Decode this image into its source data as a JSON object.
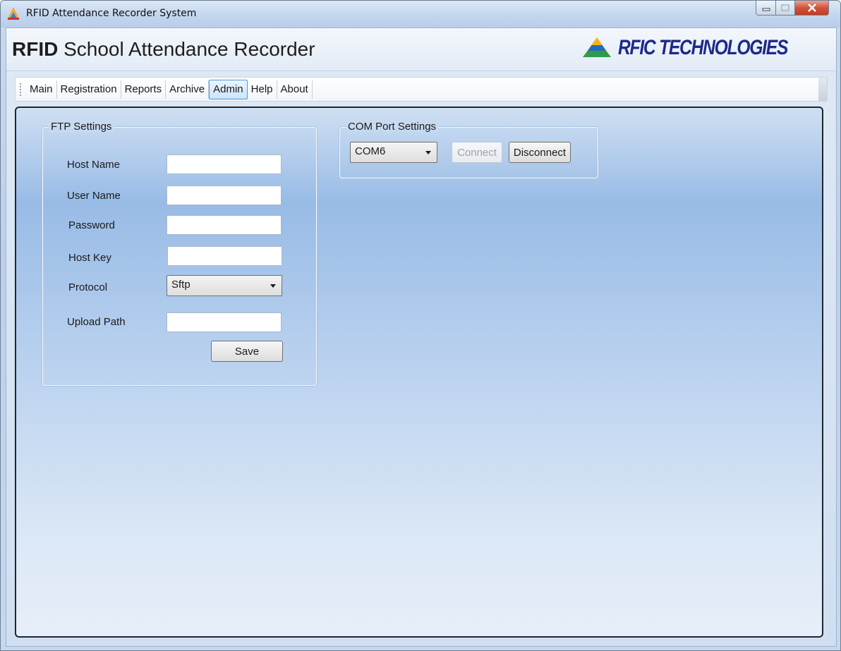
{
  "window": {
    "title": "RFID Attendance Recorder System",
    "controls": [
      "minimize-icon",
      "maximize-icon",
      "close-icon"
    ]
  },
  "header": {
    "title_bold": "RFID",
    "title_rest": " School Attendance Recorder",
    "logo_text": "RFIC TECHNOLOGIES"
  },
  "menu": {
    "items": [
      {
        "label": "Main",
        "active": false
      },
      {
        "label": "Registration",
        "active": false
      },
      {
        "label": "Reports",
        "active": false
      },
      {
        "label": "Archive",
        "active": false
      },
      {
        "label": "Admin",
        "active": true
      },
      {
        "label": "Help",
        "active": false
      },
      {
        "label": "About",
        "active": false
      }
    ]
  },
  "ftp": {
    "group_title": "FTP Settings",
    "host_name_label": "Host Name",
    "host_name_value": "",
    "user_name_label": "User Name",
    "user_name_value": "",
    "password_label": "Password",
    "password_value": "",
    "host_key_label": "Host Key",
    "host_key_value": "",
    "protocol_label": "Protocol",
    "protocol_value": "Sftp",
    "upload_path_label": "Upload Path",
    "upload_path_value": "",
    "save_label": "Save"
  },
  "com": {
    "group_title": "COM Port Settings",
    "port_value": "COM6",
    "connect_label": "Connect",
    "connect_enabled": false,
    "disconnect_label": "Disconnect"
  },
  "colors": {
    "logo_text": "#1c2a8a",
    "active_menu_border": "#4b9ad8",
    "close_button": "#c13b22"
  }
}
